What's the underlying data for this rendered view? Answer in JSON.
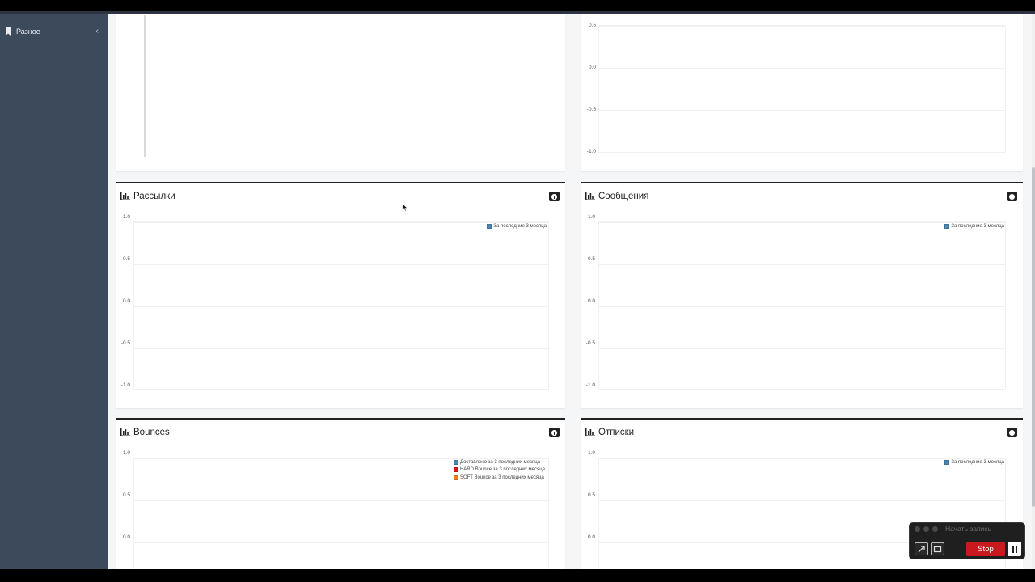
{
  "sidebar": {
    "items": [
      {
        "label": "Разное",
        "icon": "bookmark-icon",
        "chevron": "‹"
      }
    ]
  },
  "panels": {
    "top_right_chart": {
      "chart_data": {
        "type": "line",
        "yticks": [
          "0.5",
          "0.0",
          "-0.5",
          "-1.0"
        ]
      }
    },
    "mailings": {
      "title": "Рассылки",
      "chart_data": {
        "type": "bar",
        "yticks": [
          "1.0",
          "0.5",
          "0.0",
          "-0.5",
          "-1.0"
        ],
        "ylim": [
          -1,
          1
        ],
        "series": [
          {
            "name": "За последние 3 месяца",
            "color": "#4a88b4",
            "values": []
          }
        ]
      }
    },
    "messages": {
      "title": "Сообщения",
      "chart_data": {
        "type": "bar",
        "yticks": [
          "1.0",
          "0.5",
          "0.0",
          "-0.5",
          "-1.0"
        ],
        "ylim": [
          -1,
          1
        ],
        "series": [
          {
            "name": "За последние 3 месяца",
            "color": "#4a88b4",
            "values": []
          }
        ]
      }
    },
    "bounces": {
      "title": "Bounces",
      "chart_data": {
        "type": "bar",
        "yticks": [
          "1.0",
          "0.5",
          "0.0"
        ],
        "ylim": [
          -1,
          1
        ],
        "series": [
          {
            "name": "Доставлено за 3 последних месяца",
            "color": "#4a88b4",
            "values": []
          },
          {
            "name": "HARD Bounce за 3 последних месяца",
            "color": "#d9161b",
            "values": []
          },
          {
            "name": "SOFT Bounce за 3 последних месяца",
            "color": "#e8821e",
            "values": []
          }
        ]
      }
    },
    "unsubscribes": {
      "title": "Отписки",
      "chart_data": {
        "type": "bar",
        "yticks": [
          "1.0",
          "0.5",
          "0.0"
        ],
        "ylim": [
          -1,
          1
        ],
        "series": [
          {
            "name": "За последние 3 месяца",
            "color": "#4a88b4",
            "values": []
          }
        ]
      }
    }
  },
  "recorder": {
    "title": "Начать запись",
    "stop_label": "Stop"
  },
  "colors": {
    "sidebar_bg": "#3d4a5c",
    "stop_red": "#c8191e"
  }
}
